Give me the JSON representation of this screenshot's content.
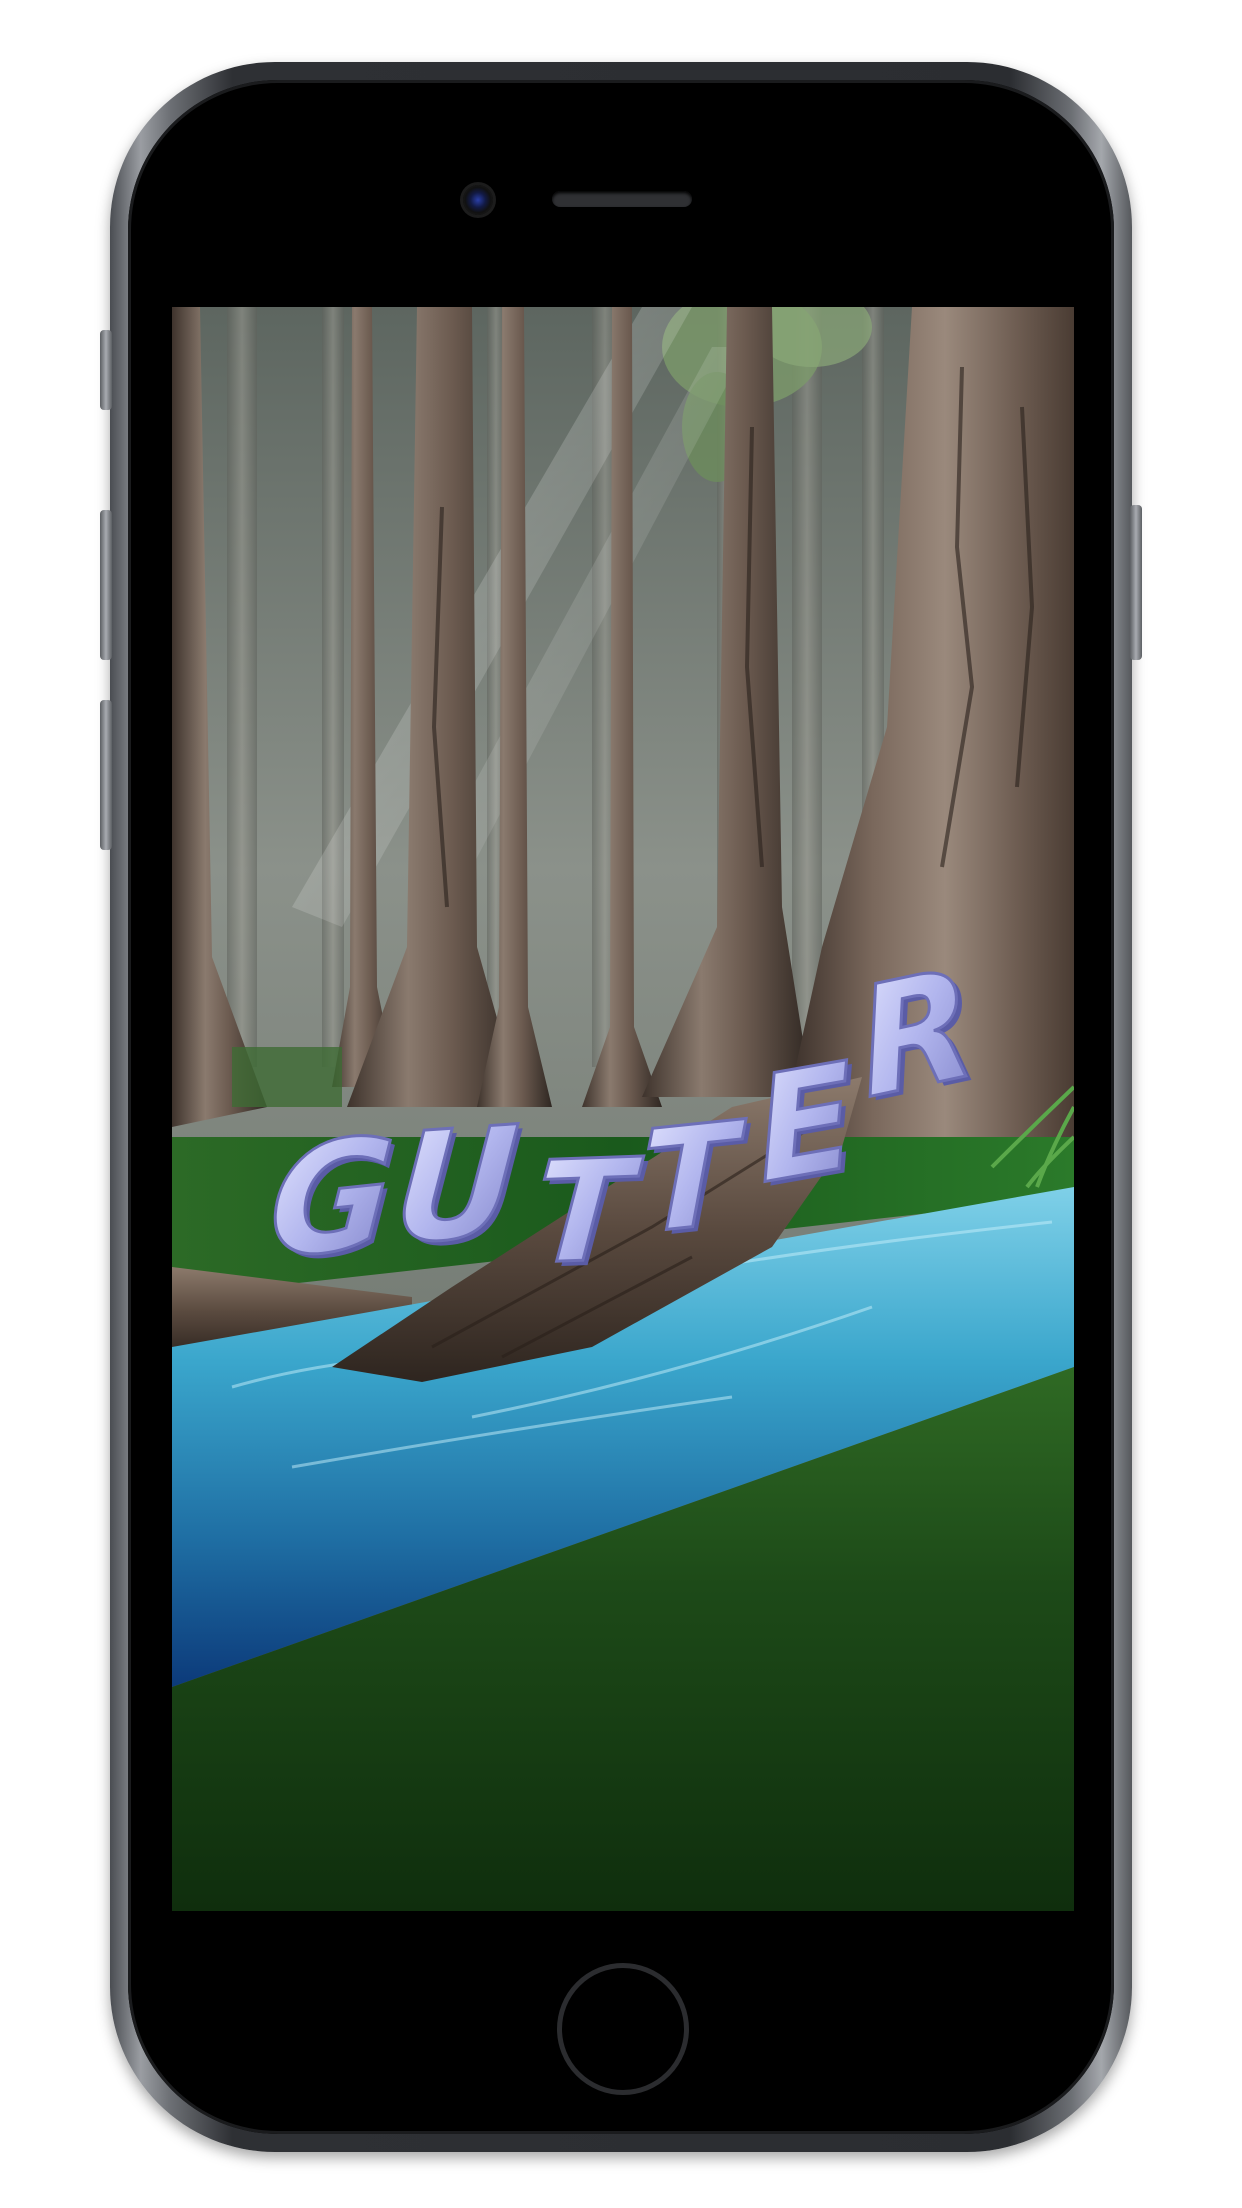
{
  "app": {
    "name": "GUTTER"
  },
  "scene": {
    "title_word": "GUTTER",
    "title_letters": [
      "G",
      "U",
      "T",
      "T",
      "E",
      "R"
    ],
    "setting": "forest-river",
    "colors": {
      "title_fill": "#b9bdf2",
      "title_shadow": "#6d6fb8",
      "water": "#2a8fb6",
      "grass": "#1b4a18",
      "bark": "#6b5a4e",
      "fog": "#8a9088"
    }
  },
  "device": {
    "model_icon": "phone-icon",
    "home_button_icon": "home-button-icon"
  }
}
